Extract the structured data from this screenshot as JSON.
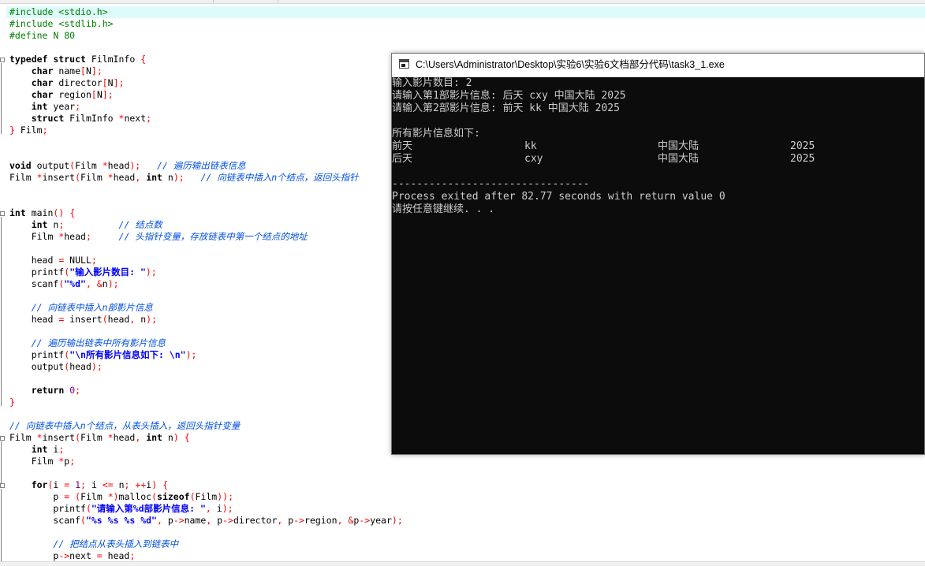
{
  "editor": {
    "lines": [
      {
        "segs": [
          {
            "c": "pp",
            "t": "#include <stdio.h>"
          }
        ]
      },
      {
        "segs": [
          {
            "c": "pp",
            "t": "#include <stdlib.h>"
          }
        ]
      },
      {
        "segs": [
          {
            "c": "pp",
            "t": "#define N 80"
          }
        ]
      },
      {
        "segs": []
      },
      {
        "segs": [
          {
            "c": "kw",
            "t": "typedef struct"
          },
          {
            "c": "",
            "t": " FilmInfo "
          },
          {
            "c": "sym",
            "t": "{"
          }
        ]
      },
      {
        "segs": [
          {
            "c": "",
            "t": "    "
          },
          {
            "c": "kw",
            "t": "char"
          },
          {
            "c": "",
            "t": " name"
          },
          {
            "c": "sym",
            "t": "["
          },
          {
            "c": "",
            "t": "N"
          },
          {
            "c": "sym",
            "t": "];"
          }
        ]
      },
      {
        "segs": [
          {
            "c": "",
            "t": "    "
          },
          {
            "c": "kw",
            "t": "char"
          },
          {
            "c": "",
            "t": " director"
          },
          {
            "c": "sym",
            "t": "["
          },
          {
            "c": "",
            "t": "N"
          },
          {
            "c": "sym",
            "t": "];"
          }
        ]
      },
      {
        "segs": [
          {
            "c": "",
            "t": "    "
          },
          {
            "c": "kw",
            "t": "char"
          },
          {
            "c": "",
            "t": " region"
          },
          {
            "c": "sym",
            "t": "["
          },
          {
            "c": "",
            "t": "N"
          },
          {
            "c": "sym",
            "t": "];"
          }
        ]
      },
      {
        "segs": [
          {
            "c": "",
            "t": "    "
          },
          {
            "c": "kw",
            "t": "int"
          },
          {
            "c": "",
            "t": " year"
          },
          {
            "c": "sym",
            "t": ";"
          }
        ]
      },
      {
        "segs": [
          {
            "c": "",
            "t": "    "
          },
          {
            "c": "kw",
            "t": "struct"
          },
          {
            "c": "",
            "t": " FilmInfo "
          },
          {
            "c": "sym",
            "t": "*"
          },
          {
            "c": "",
            "t": "next"
          },
          {
            "c": "sym",
            "t": ";"
          }
        ]
      },
      {
        "segs": [
          {
            "c": "sym",
            "t": "}"
          },
          {
            "c": "",
            "t": " Film"
          },
          {
            "c": "sym",
            "t": ";"
          }
        ]
      },
      {
        "segs": []
      },
      {
        "segs": []
      },
      {
        "segs": [
          {
            "c": "kw",
            "t": "void"
          },
          {
            "c": "",
            "t": " output"
          },
          {
            "c": "sym",
            "t": "("
          },
          {
            "c": "",
            "t": "Film "
          },
          {
            "c": "sym",
            "t": "*"
          },
          {
            "c": "",
            "t": "head"
          },
          {
            "c": "sym",
            "t": ");"
          },
          {
            "c": "",
            "t": "   "
          },
          {
            "c": "cm",
            "t": "// 遍历输出链表信息"
          }
        ]
      },
      {
        "segs": [
          {
            "c": "",
            "t": "Film "
          },
          {
            "c": "sym",
            "t": "*"
          },
          {
            "c": "",
            "t": "insert"
          },
          {
            "c": "sym",
            "t": "("
          },
          {
            "c": "",
            "t": "Film "
          },
          {
            "c": "sym",
            "t": "*"
          },
          {
            "c": "",
            "t": "head"
          },
          {
            "c": "sym",
            "t": ","
          },
          {
            "c": "",
            "t": " "
          },
          {
            "c": "kw",
            "t": "int"
          },
          {
            "c": "",
            "t": " n"
          },
          {
            "c": "sym",
            "t": ");"
          },
          {
            "c": "",
            "t": "   "
          },
          {
            "c": "cm",
            "t": "// 向链表中插入n个结点，返回头指针"
          }
        ]
      },
      {
        "segs": []
      },
      {
        "segs": []
      },
      {
        "segs": [
          {
            "c": "kw",
            "t": "int"
          },
          {
            "c": "",
            "t": " main"
          },
          {
            "c": "sym",
            "t": "()"
          },
          {
            "c": "",
            "t": " "
          },
          {
            "c": "sym",
            "t": "{"
          }
        ]
      },
      {
        "segs": [
          {
            "c": "",
            "t": "    "
          },
          {
            "c": "kw",
            "t": "int"
          },
          {
            "c": "",
            "t": " n"
          },
          {
            "c": "sym",
            "t": ";"
          },
          {
            "c": "",
            "t": "          "
          },
          {
            "c": "cm",
            "t": "// 结点数"
          }
        ]
      },
      {
        "segs": [
          {
            "c": "",
            "t": "    Film "
          },
          {
            "c": "sym",
            "t": "*"
          },
          {
            "c": "",
            "t": "head"
          },
          {
            "c": "sym",
            "t": ";"
          },
          {
            "c": "",
            "t": "     "
          },
          {
            "c": "cm",
            "t": "// 头指针变量，存放链表中第一个结点的地址"
          }
        ]
      },
      {
        "segs": []
      },
      {
        "segs": [
          {
            "c": "",
            "t": "    head "
          },
          {
            "c": "sym",
            "t": "="
          },
          {
            "c": "",
            "t": " NULL"
          },
          {
            "c": "sym",
            "t": ";"
          }
        ]
      },
      {
        "segs": [
          {
            "c": "",
            "t": "    printf"
          },
          {
            "c": "sym",
            "t": "("
          },
          {
            "c": "str",
            "t": "\"输入影片数目: \""
          },
          {
            "c": "sym",
            "t": ");"
          }
        ]
      },
      {
        "segs": [
          {
            "c": "",
            "t": "    scanf"
          },
          {
            "c": "sym",
            "t": "("
          },
          {
            "c": "str",
            "t": "\"%d\""
          },
          {
            "c": "sym",
            "t": ","
          },
          {
            "c": "",
            "t": " "
          },
          {
            "c": "sym",
            "t": "&"
          },
          {
            "c": "",
            "t": "n"
          },
          {
            "c": "sym",
            "t": ");"
          }
        ]
      },
      {
        "segs": []
      },
      {
        "segs": [
          {
            "c": "",
            "t": "    "
          },
          {
            "c": "cm",
            "t": "// 向链表中插入n部影片信息"
          }
        ]
      },
      {
        "segs": [
          {
            "c": "",
            "t": "    head "
          },
          {
            "c": "sym",
            "t": "="
          },
          {
            "c": "",
            "t": " insert"
          },
          {
            "c": "sym",
            "t": "("
          },
          {
            "c": "",
            "t": "head"
          },
          {
            "c": "sym",
            "t": ","
          },
          {
            "c": "",
            "t": " n"
          },
          {
            "c": "sym",
            "t": ");"
          }
        ]
      },
      {
        "segs": []
      },
      {
        "segs": [
          {
            "c": "",
            "t": "    "
          },
          {
            "c": "cm",
            "t": "// 遍历输出链表中所有影片信息"
          }
        ]
      },
      {
        "segs": [
          {
            "c": "",
            "t": "    printf"
          },
          {
            "c": "sym",
            "t": "("
          },
          {
            "c": "str",
            "t": "\"\\n所有影片信息如下: \\n\""
          },
          {
            "c": "sym",
            "t": ");"
          }
        ]
      },
      {
        "segs": [
          {
            "c": "",
            "t": "    output"
          },
          {
            "c": "sym",
            "t": "("
          },
          {
            "c": "",
            "t": "head"
          },
          {
            "c": "sym",
            "t": ");"
          }
        ]
      },
      {
        "segs": []
      },
      {
        "segs": [
          {
            "c": "",
            "t": "    "
          },
          {
            "c": "kw",
            "t": "return"
          },
          {
            "c": "",
            "t": " "
          },
          {
            "c": "num",
            "t": "0"
          },
          {
            "c": "sym",
            "t": ";"
          }
        ]
      },
      {
        "segs": [
          {
            "c": "sym",
            "t": "}"
          }
        ]
      },
      {
        "segs": []
      },
      {
        "segs": [
          {
            "c": "cm",
            "t": "// 向链表中插入n个结点，从表头插入，返回头指针变量"
          }
        ]
      },
      {
        "segs": [
          {
            "c": "",
            "t": "Film "
          },
          {
            "c": "sym",
            "t": "*"
          },
          {
            "c": "",
            "t": "insert"
          },
          {
            "c": "sym",
            "t": "("
          },
          {
            "c": "",
            "t": "Film "
          },
          {
            "c": "sym",
            "t": "*"
          },
          {
            "c": "",
            "t": "head"
          },
          {
            "c": "sym",
            "t": ","
          },
          {
            "c": "",
            "t": " "
          },
          {
            "c": "kw",
            "t": "int"
          },
          {
            "c": "",
            "t": " n"
          },
          {
            "c": "sym",
            "t": ")"
          },
          {
            "c": "",
            "t": " "
          },
          {
            "c": "sym",
            "t": "{"
          }
        ]
      },
      {
        "segs": [
          {
            "c": "",
            "t": "    "
          },
          {
            "c": "kw",
            "t": "int"
          },
          {
            "c": "",
            "t": " i"
          },
          {
            "c": "sym",
            "t": ";"
          }
        ]
      },
      {
        "segs": [
          {
            "c": "",
            "t": "    Film "
          },
          {
            "c": "sym",
            "t": "*"
          },
          {
            "c": "",
            "t": "p"
          },
          {
            "c": "sym",
            "t": ";"
          }
        ]
      },
      {
        "segs": []
      },
      {
        "segs": [
          {
            "c": "",
            "t": "    "
          },
          {
            "c": "kw",
            "t": "for"
          },
          {
            "c": "sym",
            "t": "("
          },
          {
            "c": "",
            "t": "i "
          },
          {
            "c": "sym",
            "t": "="
          },
          {
            "c": "",
            "t": " "
          },
          {
            "c": "num",
            "t": "1"
          },
          {
            "c": "sym",
            "t": ";"
          },
          {
            "c": "",
            "t": " i "
          },
          {
            "c": "sym",
            "t": "<="
          },
          {
            "c": "",
            "t": " n"
          },
          {
            "c": "sym",
            "t": ";"
          },
          {
            "c": "",
            "t": " "
          },
          {
            "c": "sym",
            "t": "++"
          },
          {
            "c": "",
            "t": "i"
          },
          {
            "c": "sym",
            "t": ")"
          },
          {
            "c": "",
            "t": " "
          },
          {
            "c": "sym",
            "t": "{"
          }
        ]
      },
      {
        "segs": [
          {
            "c": "",
            "t": "        p "
          },
          {
            "c": "sym",
            "t": "="
          },
          {
            "c": "",
            "t": " "
          },
          {
            "c": "sym",
            "t": "("
          },
          {
            "c": "",
            "t": "Film "
          },
          {
            "c": "sym",
            "t": "*)"
          },
          {
            "c": "",
            "t": "malloc"
          },
          {
            "c": "sym",
            "t": "("
          },
          {
            "c": "kw",
            "t": "sizeof"
          },
          {
            "c": "sym",
            "t": "("
          },
          {
            "c": "",
            "t": "Film"
          },
          {
            "c": "sym",
            "t": "));"
          }
        ]
      },
      {
        "segs": [
          {
            "c": "",
            "t": "        printf"
          },
          {
            "c": "sym",
            "t": "("
          },
          {
            "c": "str",
            "t": "\"请输入第%d部影片信息: \""
          },
          {
            "c": "sym",
            "t": ","
          },
          {
            "c": "",
            "t": " i"
          },
          {
            "c": "sym",
            "t": ");"
          }
        ]
      },
      {
        "segs": [
          {
            "c": "",
            "t": "        scanf"
          },
          {
            "c": "sym",
            "t": "("
          },
          {
            "c": "str",
            "t": "\"%s %s %s %d\""
          },
          {
            "c": "sym",
            "t": ","
          },
          {
            "c": "",
            "t": " p"
          },
          {
            "c": "sym",
            "t": "->"
          },
          {
            "c": "",
            "t": "name"
          },
          {
            "c": "sym",
            "t": ","
          },
          {
            "c": "",
            "t": " p"
          },
          {
            "c": "sym",
            "t": "->"
          },
          {
            "c": "",
            "t": "director"
          },
          {
            "c": "sym",
            "t": ","
          },
          {
            "c": "",
            "t": " p"
          },
          {
            "c": "sym",
            "t": "->"
          },
          {
            "c": "",
            "t": "region"
          },
          {
            "c": "sym",
            "t": ","
          },
          {
            "c": "",
            "t": " "
          },
          {
            "c": "sym",
            "t": "&"
          },
          {
            "c": "",
            "t": "p"
          },
          {
            "c": "sym",
            "t": "->"
          },
          {
            "c": "",
            "t": "year"
          },
          {
            "c": "sym",
            "t": ");"
          }
        ]
      },
      {
        "segs": []
      },
      {
        "segs": [
          {
            "c": "",
            "t": "        "
          },
          {
            "c": "cm",
            "t": "// 把结点从表头插入到链表中"
          }
        ]
      },
      {
        "segs": [
          {
            "c": "",
            "t": "        p"
          },
          {
            "c": "sym",
            "t": "->"
          },
          {
            "c": "",
            "t": "next "
          },
          {
            "c": "sym",
            "t": "="
          },
          {
            "c": "",
            "t": " head"
          },
          {
            "c": "sym",
            "t": ";"
          }
        ]
      }
    ]
  },
  "console": {
    "title": "C:\\Users\\Administrator\\Desktop\\实验6\\实验6文档部分代码\\task3_1.exe",
    "lines_top": [
      "输入影片数目: 2",
      "请输入第1部影片信息: 后天 cxy 中国大陆 2025",
      "请输入第2部影片信息: 前天 kk 中国大陆 2025",
      "",
      "所有影片信息如下:"
    ],
    "table": [
      [
        "前天",
        "kk",
        "中国大陆",
        "2025"
      ],
      [
        "后天",
        "cxy",
        "中国大陆",
        "2025"
      ]
    ],
    "lines_bottom": [
      "",
      "--------------------------------",
      "Process exited after 82.77 seconds with return value 0",
      "请按任意键继续. . ."
    ]
  }
}
